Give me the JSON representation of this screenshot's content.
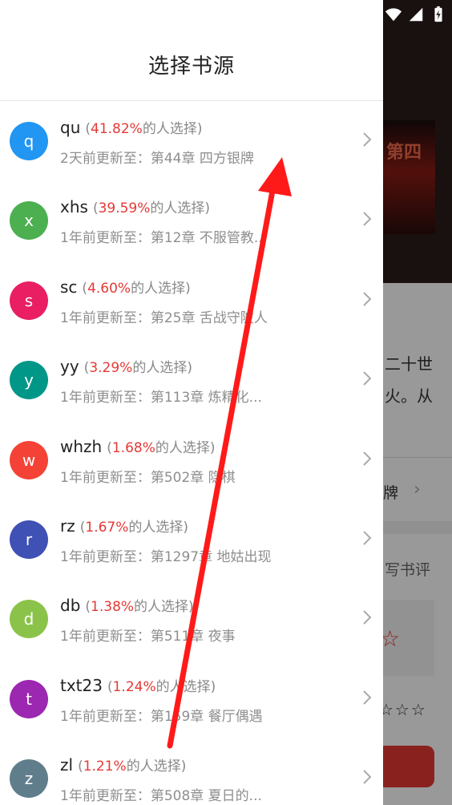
{
  "drawer": {
    "title": "选择书源"
  },
  "colors": {
    "accent_red": "#e53935",
    "arrow_red": "#ff1a1a"
  },
  "background": {
    "cover_text": "第四",
    "intro_line1": "二十世",
    "intro_line2": "火。从",
    "row_text": "牌",
    "review_text": "写书评",
    "star": "☆",
    "stars": "☆☆☆"
  },
  "sources": [
    {
      "letter": "q",
      "name": "qu",
      "open": "(",
      "percent": "41.82%",
      "suffix": "的人选择)",
      "update": "2天前更新至：第44章 四方银牌",
      "avatar_color": "#2196f3"
    },
    {
      "letter": "x",
      "name": "xhs",
      "open": "(",
      "percent": "39.59%",
      "suffix": "的人选择)",
      "update": "1年前更新至：第12章 不服管教...",
      "avatar_color": "#4caf50"
    },
    {
      "letter": "s",
      "name": "sc",
      "open": "(",
      "percent": "4.60%",
      "suffix": "的人选择)",
      "update": "1年前更新至：第25章 舌战守陂人",
      "avatar_color": "#e91e63"
    },
    {
      "letter": "y",
      "name": "yy",
      "open": "(",
      "percent": "3.29%",
      "suffix": "的人选择)",
      "update": "1年前更新至：第113章 炼精化...",
      "avatar_color": "#009688"
    },
    {
      "letter": "w",
      "name": "whzh",
      "open": "(",
      "percent": "1.68%",
      "suffix": "的人选择)",
      "update": "1年前更新至：第502章 隐棋",
      "avatar_color": "#f44336"
    },
    {
      "letter": "r",
      "name": "rz",
      "open": "(",
      "percent": "1.67%",
      "suffix": "的人选择)",
      "update": "1年前更新至：第1297章 地姑出现",
      "avatar_color": "#3f51b5"
    },
    {
      "letter": "d",
      "name": "db",
      "open": "(",
      "percent": "1.38%",
      "suffix": "的人选择)",
      "update": "1年前更新至：第511章 夜事",
      "avatar_color": "#8bc34a"
    },
    {
      "letter": "t",
      "name": "txt23",
      "open": "(",
      "percent": "1.24%",
      "suffix": "的人选择)",
      "update": "1年前更新至：第159章 餐厅偶遇",
      "avatar_color": "#9c27b0"
    },
    {
      "letter": "z",
      "name": "zl",
      "open": "(",
      "percent": "1.21%",
      "suffix": "的人选择)",
      "update": "1年前更新至：第508章 夏日的...",
      "avatar_color": "#607d8b"
    }
  ]
}
